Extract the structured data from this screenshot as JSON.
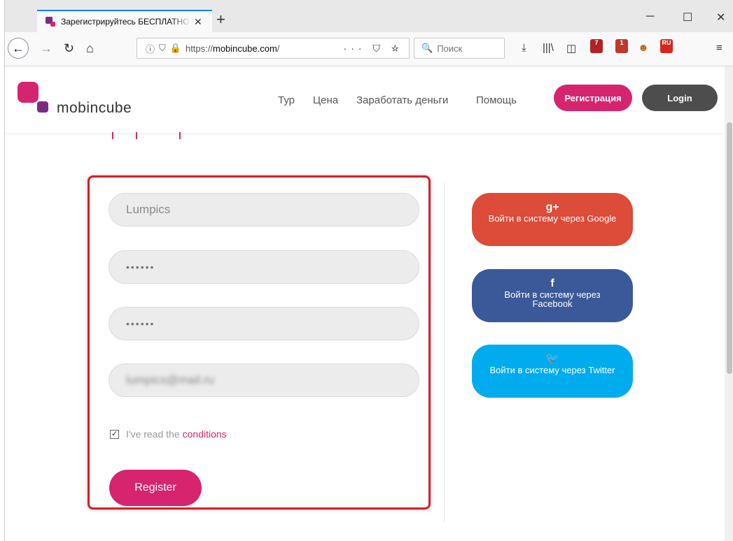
{
  "browser": {
    "tab_title": "Зарегистрируйтесь БЕСПЛАТНО",
    "tab_close": "✕",
    "new_tab": "+",
    "window_controls": [
      "─",
      "☐",
      "✕"
    ],
    "url_prefix": "https://",
    "url_domain": "mobincube.com",
    "url_suffix": "/",
    "url_actions": "··· ⛉ ☆",
    "search_placeholder": "Поиск",
    "ext_badges": [
      "7",
      "1",
      "RU"
    ]
  },
  "site": {
    "brand": "mobincube",
    "menu": [
      "Тур",
      "Цена",
      "Заработать деньги",
      "Помощь"
    ],
    "register_label": "Регистрация",
    "login_label": "Login"
  },
  "form": {
    "username_value": "Lumpics",
    "password_value": "••••••",
    "password_confirm_value": "••••••",
    "email_value": "lumpics@mail.ru",
    "conditions_text": "I've read the",
    "conditions_link": "conditions",
    "conditions_checked": true,
    "register_button": "Register"
  },
  "social": {
    "google": {
      "icon": "g+",
      "label": "Войти в систему через Google",
      "color": "#dd4b39"
    },
    "facebook": {
      "icon": "f",
      "label": "Войти в систему через Facebook",
      "color": "#3b5998"
    },
    "twitter": {
      "icon": "🐦",
      "label": "Войти в систему через Twitter",
      "color": "#00aced"
    }
  },
  "colors": {
    "accent": "#d6246e",
    "dark_button": "#4d4d4d",
    "highlight_border": "#d41f2a"
  }
}
